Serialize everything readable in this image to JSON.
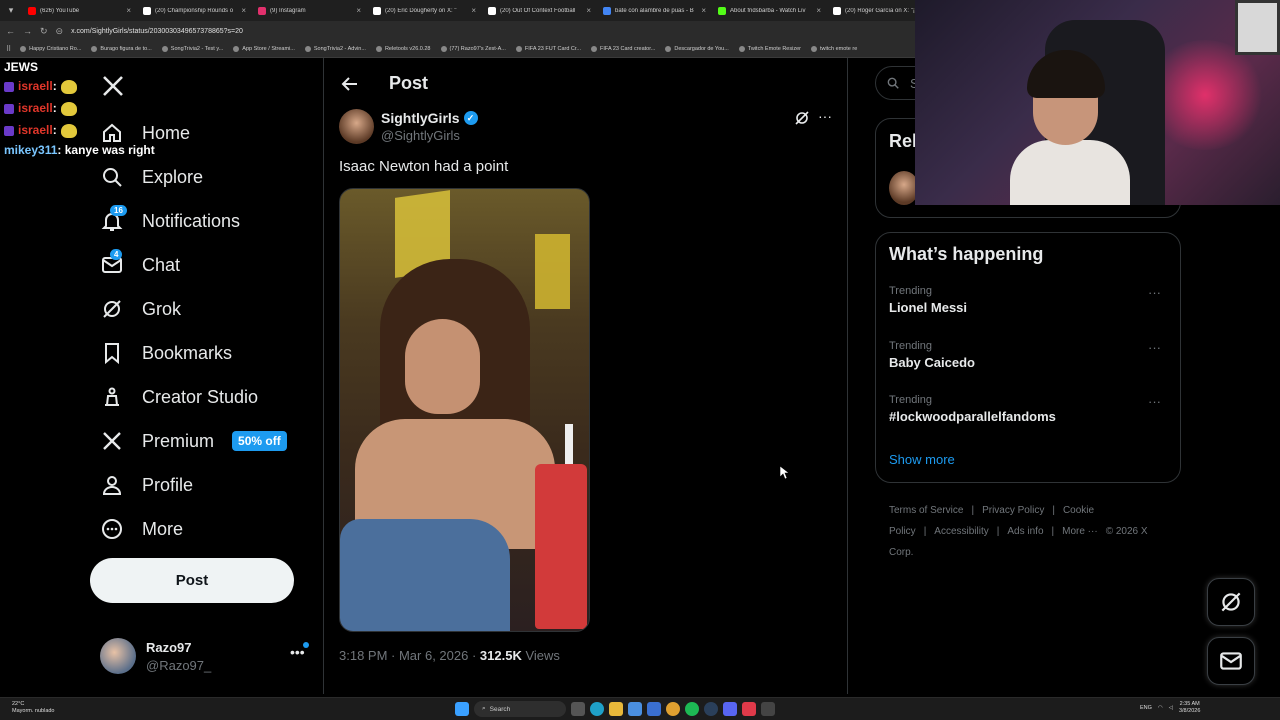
{
  "browser": {
    "tabs": [
      {
        "title": "(626) YouTube",
        "color": "#ff0000"
      },
      {
        "title": "(20) Championship Rounds o",
        "color": "#ffffff"
      },
      {
        "title": "(9) Instagram",
        "color": "#e1306c"
      },
      {
        "title": "(20) Eric Dougherty on X: \"",
        "color": "#ffffff"
      },
      {
        "title": "(20) Out Of Context Football",
        "color": "#ffffff"
      },
      {
        "title": "bate con alambre de puas - B",
        "color": "#4285f4"
      },
      {
        "title": "About fridsbarba - Watch Liv",
        "color": "#53fc18"
      },
      {
        "title": "(20) Roger García on X: \"¡Es",
        "color": "#ffffff"
      }
    ],
    "url": "x.com/SightlyGirls/status/2030030349657378865?s=20",
    "bookmarks": [
      "Happy Cristiano Ro...",
      "Burago figura de to...",
      "SongTrivia2 - Test y...",
      "App Store / Streami...",
      "SongTrivia2 - Advin...",
      "Reletools v26.0.28",
      "(77) Razo97's Zest-A...",
      "FIFA 23 FUT Card Cr...",
      "FIFA 23 Card creator...",
      "Descargador de You...",
      "Twitch Emote Resizer",
      "twitch emote re"
    ]
  },
  "chat_overlay": {
    "title": "JEWS",
    "lines": [
      {
        "user": "israell",
        "text": ":"
      },
      {
        "user": "israell",
        "text": ":"
      },
      {
        "user": "israell",
        "text": ":"
      },
      {
        "user": "mikey311",
        "text": ": kanye was right"
      }
    ]
  },
  "nav": {
    "items": [
      {
        "label": "Home",
        "icon": "home-icon"
      },
      {
        "label": "Explore",
        "icon": "search-icon"
      },
      {
        "label": "Notifications",
        "icon": "bell-icon",
        "badge": "16"
      },
      {
        "label": "Chat",
        "icon": "mail-icon",
        "badge": "4"
      },
      {
        "label": "Grok",
        "icon": "grok-icon"
      },
      {
        "label": "Bookmarks",
        "icon": "bookmark-icon"
      },
      {
        "label": "Creator Studio",
        "icon": "creator-studio-icon"
      },
      {
        "label": "Premium",
        "icon": "x-icon",
        "pill": "50% off"
      },
      {
        "label": "Profile",
        "icon": "person-icon"
      },
      {
        "label": "More",
        "icon": "more-circle-icon"
      }
    ],
    "post_button": "Post",
    "account": {
      "name": "Razo97",
      "handle": "@Razo97_"
    }
  },
  "post": {
    "header": "Post",
    "author_name": "SightlyGirls",
    "author_handle": "@SightlyGirls",
    "text": "Isaac Newton had a point",
    "time": "3:18 PM · Mar 6, 2026 ·",
    "views_count": "312.5K",
    "views_label": "Views"
  },
  "sidebar": {
    "search_placeholder": "Se",
    "relevant_title": "Rel",
    "happening_title": "What’s happening",
    "trends": [
      {
        "category": "Trending",
        "name": "Lionel Messi"
      },
      {
        "category": "Trending",
        "name": "Baby Caicedo"
      },
      {
        "category": "Trending",
        "name": "#lockwoodparallelfandoms"
      }
    ],
    "show_more": "Show more",
    "footer": [
      "Terms of Service",
      "|",
      "Privacy Policy",
      "|",
      "Cookie Policy",
      "|",
      "Accessibility",
      "|",
      "Ads info",
      "|",
      "More ···",
      "© 2026 X Corp."
    ]
  },
  "taskbar": {
    "weather_temp": "22°C",
    "weather_desc": "Mayorm. nublado",
    "search": "Search",
    "lang": "ENG",
    "time": "2:35 AM",
    "date": "3/8/2026"
  },
  "colors": {
    "accent": "#1d9bf0",
    "background": "#000000",
    "chat_user": "#e0362a"
  }
}
